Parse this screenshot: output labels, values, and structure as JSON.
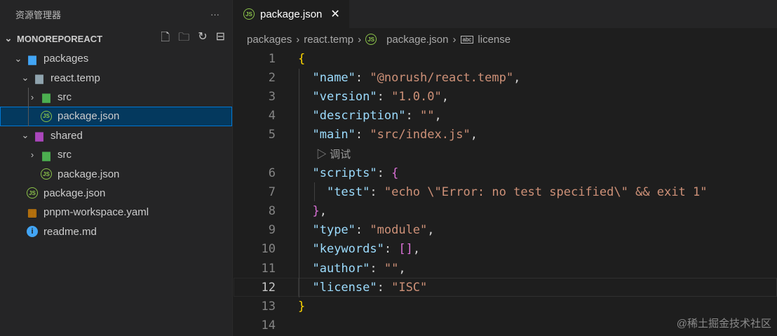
{
  "sidebar": {
    "title": "资源管理器",
    "more": "···",
    "workspace": "MONOREPOREACT",
    "tree": [
      {
        "label": "packages",
        "depth": 0,
        "chev": "⌄",
        "icon": "folder-packages-icon"
      },
      {
        "label": "react.temp",
        "depth": 1,
        "chev": "⌄",
        "icon": "folder-open-icon"
      },
      {
        "label": "src",
        "depth": 2,
        "chev": "›",
        "icon": "folder-src-icon"
      },
      {
        "label": "package.json",
        "depth": 2,
        "chev": "",
        "icon": "json-icon",
        "selected": true
      },
      {
        "label": "shared",
        "depth": 1,
        "chev": "⌄",
        "icon": "folder-shared-icon"
      },
      {
        "label": "src",
        "depth": 2,
        "chev": "›",
        "icon": "folder-src-icon"
      },
      {
        "label": "package.json",
        "depth": 2,
        "chev": "",
        "icon": "json-icon"
      },
      {
        "label": "package.json",
        "depth": 0,
        "chev": "",
        "icon": "json-icon"
      },
      {
        "label": "pnpm-workspace.yaml",
        "depth": 0,
        "chev": "",
        "icon": "yaml-icon"
      },
      {
        "label": "readme.md",
        "depth": 0,
        "chev": "",
        "icon": "info-icon"
      }
    ]
  },
  "tab": {
    "label": "package.json",
    "close": "✕"
  },
  "breadcrumb": [
    "packages",
    "react.temp",
    "package.json",
    "license"
  ],
  "codelens": "调试",
  "code": [
    {
      "n": "1",
      "t": [
        [
          "b1",
          "{"
        ]
      ]
    },
    {
      "n": "2",
      "t": [
        [
          "p",
          "  "
        ],
        [
          "k",
          "\"name\""
        ],
        [
          "p",
          ": "
        ],
        [
          "s",
          "\"@norush/react.temp\""
        ],
        [
          "p",
          ","
        ]
      ]
    },
    {
      "n": "3",
      "t": [
        [
          "p",
          "  "
        ],
        [
          "k",
          "\"version\""
        ],
        [
          "p",
          ": "
        ],
        [
          "s",
          "\"1.0.0\""
        ],
        [
          "p",
          ","
        ]
      ]
    },
    {
      "n": "4",
      "t": [
        [
          "p",
          "  "
        ],
        [
          "k",
          "\"description\""
        ],
        [
          "p",
          ": "
        ],
        [
          "s",
          "\"\""
        ],
        [
          "p",
          ","
        ]
      ]
    },
    {
      "n": "5",
      "t": [
        [
          "p",
          "  "
        ],
        [
          "k",
          "\"main\""
        ],
        [
          "p",
          ": "
        ],
        [
          "s",
          "\"src/index.js\""
        ],
        [
          "p",
          ","
        ]
      ]
    },
    {
      "n": "",
      "lens": true
    },
    {
      "n": "6",
      "t": [
        [
          "p",
          "  "
        ],
        [
          "k",
          "\"scripts\""
        ],
        [
          "p",
          ": "
        ],
        [
          "b2",
          "{"
        ]
      ]
    },
    {
      "n": "7",
      "t": [
        [
          "p",
          "    "
        ],
        [
          "k",
          "\"test\""
        ],
        [
          "p",
          ": "
        ],
        [
          "s",
          "\"echo \\\"Error: no test specified\\\" && exit 1\""
        ]
      ]
    },
    {
      "n": "8",
      "t": [
        [
          "p",
          "  "
        ],
        [
          "b2",
          "}"
        ],
        [
          "p",
          ","
        ]
      ]
    },
    {
      "n": "9",
      "t": [
        [
          "p",
          "  "
        ],
        [
          "k",
          "\"type\""
        ],
        [
          "p",
          ": "
        ],
        [
          "s",
          "\"module\""
        ],
        [
          "p",
          ","
        ]
      ]
    },
    {
      "n": "10",
      "t": [
        [
          "p",
          "  "
        ],
        [
          "k",
          "\"keywords\""
        ],
        [
          "p",
          ": "
        ],
        [
          "b2",
          "[]"
        ],
        [
          "p",
          ","
        ]
      ]
    },
    {
      "n": "11",
      "t": [
        [
          "p",
          "  "
        ],
        [
          "k",
          "\"author\""
        ],
        [
          "p",
          ": "
        ],
        [
          "s",
          "\"\""
        ],
        [
          "p",
          ","
        ]
      ]
    },
    {
      "n": "12",
      "t": [
        [
          "p",
          "  "
        ],
        [
          "k",
          "\"license\""
        ],
        [
          "p",
          ": "
        ],
        [
          "s",
          "\"ISC\""
        ]
      ],
      "cur": true
    },
    {
      "n": "13",
      "t": [
        [
          "b1",
          "}"
        ]
      ]
    },
    {
      "n": "14",
      "t": []
    }
  ],
  "watermark": "@稀土掘金技术社区"
}
